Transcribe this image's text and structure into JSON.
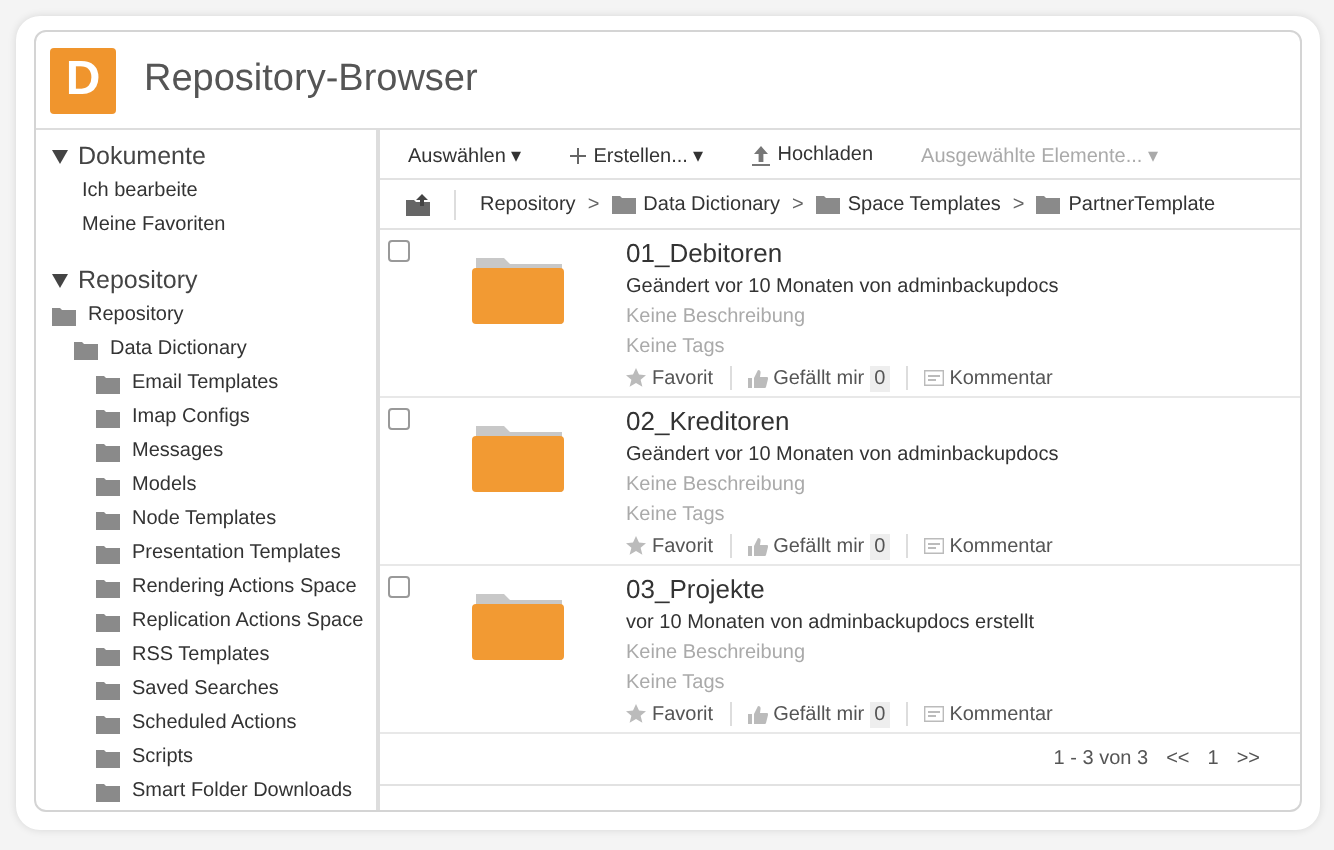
{
  "header": {
    "logo": "D",
    "title": "Repository-Browser"
  },
  "sidebar": {
    "sections": [
      {
        "label": "Dokumente",
        "expanded": true,
        "items": [
          {
            "label": "Ich bearbeite"
          },
          {
            "label": "Meine Favoriten"
          }
        ]
      },
      {
        "label": "Repository",
        "expanded": true,
        "tree": [
          {
            "label": "Repository",
            "children": [
              {
                "label": "Data Dictionary",
                "children": [
                  {
                    "label": "Email Templates"
                  },
                  {
                    "label": "Imap Configs"
                  },
                  {
                    "label": "Messages"
                  },
                  {
                    "label": "Models"
                  },
                  {
                    "label": "Node Templates"
                  },
                  {
                    "label": "Presentation Templates"
                  },
                  {
                    "label": "Rendering Actions Space"
                  },
                  {
                    "label": "Replication Actions Space"
                  },
                  {
                    "label": "RSS Templates"
                  },
                  {
                    "label": "Saved Searches"
                  },
                  {
                    "label": "Scheduled Actions"
                  },
                  {
                    "label": "Scripts"
                  },
                  {
                    "label": "Smart Folder Downloads"
                  }
                ]
              }
            ]
          }
        ]
      }
    ]
  },
  "toolbar": [
    {
      "label": "Auswählen ▾",
      "kind": "menu",
      "disabled": false
    },
    {
      "label": "Erstellen... ▾",
      "kind": "create",
      "disabled": false
    },
    {
      "label": "Hochladen",
      "kind": "upload",
      "disabled": false
    },
    {
      "label": "Ausgewählte Elemente... ▾",
      "kind": "menu",
      "disabled": true
    }
  ],
  "breadcrumb": [
    {
      "label": "Repository",
      "kind": "plain"
    },
    {
      "separator": ">",
      "label": "Data Dictionary",
      "kind": "folder"
    },
    {
      "separator": ">",
      "label": "Space Templates",
      "kind": "folder"
    },
    {
      "separator": ">",
      "label": "PartnerTemplate",
      "kind": "folder"
    }
  ],
  "items": [
    {
      "name": "01_Debitoren",
      "checked": false,
      "modified": "Geändert vor 10 Monaten von adminbackupdocs",
      "description": "Keine Beschreibung",
      "tags": "Keine Tags",
      "favorite": "Favorit",
      "like": "Gefällt mir",
      "likes": "0",
      "comment": "Kommentar"
    },
    {
      "name": "02_Kreditoren",
      "checked": false,
      "modified": "Geändert vor 10 Monaten von adminbackupdocs",
      "description": "Keine Beschreibung",
      "tags": "Keine Tags",
      "favorite": "Favorit",
      "like": "Gefällt mir",
      "likes": "0",
      "comment": "Kommentar"
    },
    {
      "name": "03_Projekte",
      "checked": false,
      "modified": "vor 10 Monaten von adminbackupdocs erstellt",
      "description": "Keine Beschreibung",
      "tags": "Keine Tags",
      "favorite": "Favorit",
      "like": "Gefällt mir",
      "likes": "0",
      "comment": "Kommentar"
    }
  ],
  "pagination": {
    "summary": "1 - 3 von 3",
    "prev": "<<",
    "page": "1",
    "next": ">>"
  }
}
